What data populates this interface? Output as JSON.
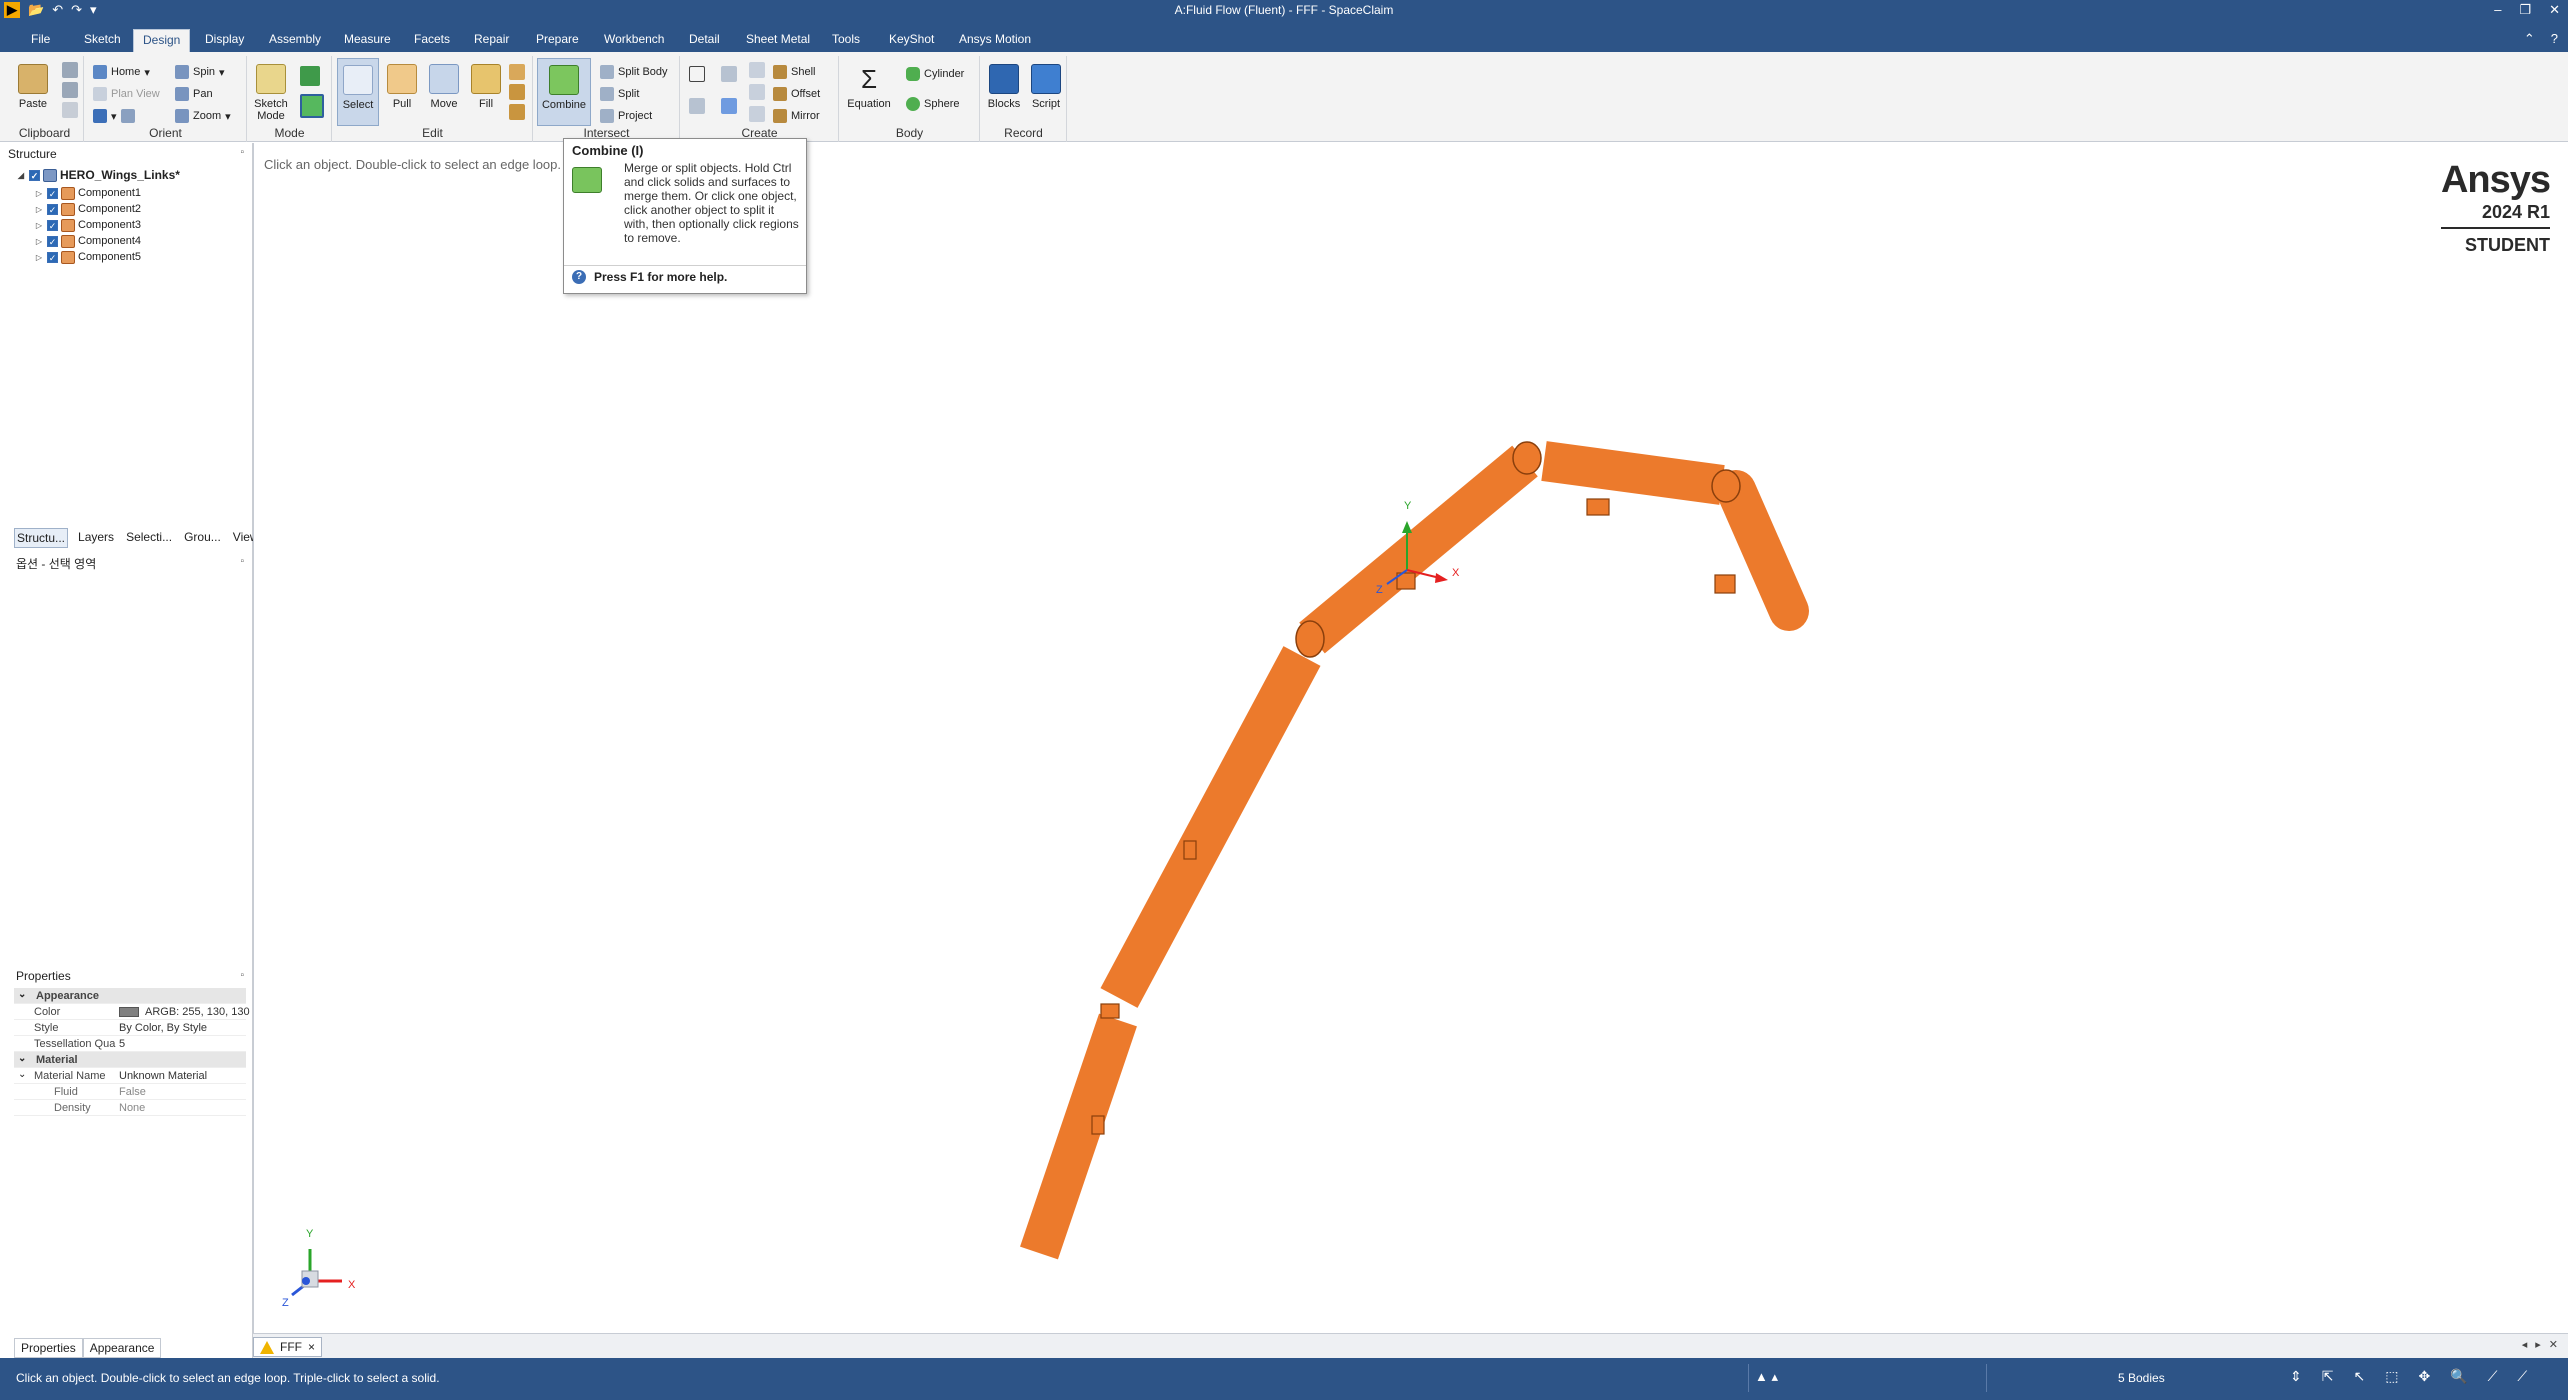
{
  "window": {
    "title": "A:Fluid Flow (Fluent) - FFF - SpaceClaim",
    "controls": [
      "–",
      "❐",
      "✕"
    ]
  },
  "menu": {
    "tabs": [
      "File",
      "Sketch",
      "Design",
      "Display",
      "Assembly",
      "Measure",
      "Facets",
      "Repair",
      "Prepare",
      "Workbench",
      "Detail",
      "Sheet Metal",
      "Tools",
      "KeyShot",
      "Ansys Motion"
    ],
    "active": "Design"
  },
  "ribbon": {
    "clipboard": {
      "label": "Clipboard",
      "paste": "Paste"
    },
    "orient": {
      "label": "Orient",
      "home": "Home",
      "plan_view": "Plan View",
      "spin": "Spin",
      "pan": "Pan",
      "zoom": "Zoom"
    },
    "mode": {
      "label": "Mode",
      "sketch_mode": "Sketch Mode"
    },
    "edit": {
      "label": "Edit",
      "select": "Select",
      "pull": "Pull",
      "move": "Move",
      "fill": "Fill"
    },
    "intersect": {
      "label": "Intersect",
      "combine": "Combine",
      "split_body": "Split Body",
      "split": "Split",
      "project": "Project"
    },
    "create": {
      "label": "Create",
      "shell": "Shell",
      "offset": "Offset",
      "mirror": "Mirror"
    },
    "body": {
      "label": "Body",
      "equation": "Equation",
      "cylinder": "Cylinder",
      "sphere": "Sphere"
    },
    "record": {
      "label": "Record",
      "blocks": "Blocks",
      "script": "Script"
    }
  },
  "structure": {
    "header": "Structure",
    "root": "HERO_Wings_Links*",
    "components": [
      "Component1",
      "Component2",
      "Component3",
      "Component4",
      "Component5"
    ],
    "tabs": [
      "Structu...",
      "Layers",
      "Selecti...",
      "Grou...",
      "Views"
    ],
    "options_label": "옵션 - 선택 영역"
  },
  "properties": {
    "header": "Properties",
    "appearance": "Appearance",
    "color_label": "Color",
    "color_value": "ARGB: 255, 130, 130",
    "style_label": "Style",
    "style_value": "By Color, By Style",
    "tess_label": "Tessellation Qua",
    "tess_value": "5",
    "material": "Material",
    "material_name_label": "Material Name",
    "material_name_value": "Unknown Material",
    "fluid_label": "Fluid",
    "fluid_value": "False",
    "density_label": "Density",
    "density_value": "None",
    "bottom_tabs": [
      "Properties",
      "Appearance"
    ]
  },
  "viewport": {
    "hint": "Click an object. Double-click to select an edge loop.",
    "brand": {
      "name": "Ansys",
      "version": "2024 R1",
      "edition": "STUDENT"
    },
    "model_color": "#ec7a2c",
    "axis": {
      "x": "X",
      "y": "Y",
      "z": "Z"
    }
  },
  "tooltip": {
    "title": "Combine (I)",
    "body": "Merge or split objects. Hold Ctrl and click solids and surfaces to merge them. Or click one object, click another object to split it with, then optionally click regions to remove.",
    "help": "Press F1 for more help."
  },
  "doc_tab": {
    "name": "FFF",
    "close": "×"
  },
  "status": {
    "text": "Click an object. Double-click to select an edge loop. Triple-click to select a solid.",
    "bodies": "5 Bodies"
  }
}
